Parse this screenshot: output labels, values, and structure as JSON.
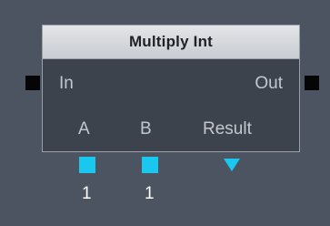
{
  "node": {
    "title": "Multiply Int",
    "exec_in_label": "In",
    "exec_out_label": "Out",
    "inputs": [
      {
        "label": "A",
        "value": "1"
      },
      {
        "label": "B",
        "value": "1"
      }
    ],
    "output": {
      "label": "Result"
    }
  },
  "colors": {
    "canvas": "#4c5361",
    "node_body": "#3d434d",
    "header": "#d7d9dd",
    "data_pin": "#19c7ef",
    "exec_pin": "#050505"
  }
}
